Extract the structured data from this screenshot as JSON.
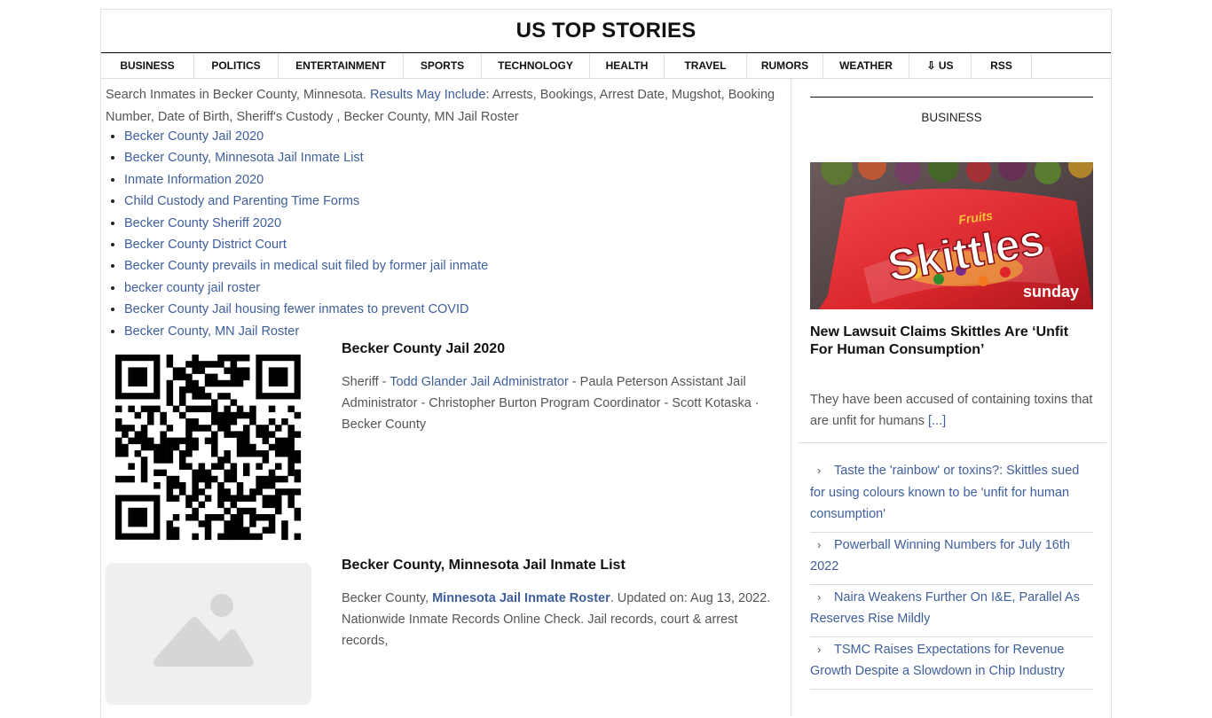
{
  "site": {
    "title": "US TOP STORIES"
  },
  "nav": [
    {
      "label": "BUSINESS",
      "w": 105
    },
    {
      "label": "POLITICS",
      "w": 95
    },
    {
      "label": "ENTERTAINMENT",
      "w": 141
    },
    {
      "label": "SPORTS",
      "w": 88
    },
    {
      "label": "TECHNOLOGY",
      "w": 122
    },
    {
      "label": "HEALTH",
      "w": 84
    },
    {
      "label": "TRAVEL",
      "w": 93
    },
    {
      "label": "RUMORS",
      "w": 86
    },
    {
      "label": "WEATHER",
      "w": 97
    },
    {
      "label": "⇩ US",
      "w": 70
    },
    {
      "label": "RSS",
      "w": 68
    }
  ],
  "intro": {
    "lead": "Search Inmates in Becker County, Minnesota. ",
    "link": "Results May Include",
    "rest": ": Arrests, Bookings, Arrest Date, Mugshot, Booking Number, Date of Birth, Sheriff's Custody ,  Becker County, MN Jail Roster"
  },
  "results": [
    "Becker County Jail 2020",
    "Becker County, Minnesota Jail Inmate List",
    "Inmate Information 2020",
    "Child Custody and Parenting Time Forms",
    "Becker County Sheriff 2020",
    "Becker County District Court",
    "Becker County prevails in medical suit filed by former jail inmate",
    "becker county jail roster",
    "Becker County Jail housing fewer inmates to prevent COVID",
    "Becker County, MN Jail Roster"
  ],
  "card1": {
    "title": "Becker County Jail 2020",
    "t1": "Sheriff - ",
    "link": "Todd Glander Jail Administrator",
    "t2": " - Paula Peterson Assistant Jail Administrator - Christopher Burton Program Coordinator - Scott Kotaska · Becker County"
  },
  "card2": {
    "title": "Becker County, Minnesota Jail Inmate List",
    "t1": "Becker County, ",
    "link": "Minnesota Jail Inmate Roster",
    "t2": ". Updated on: Aug 13, 2022. Nationwide Inmate Records Online Check. Jail records, court & arrest records,"
  },
  "sidebar": {
    "heading": "BUSINESS",
    "feature_title": "New Lawsuit Claims Skittles Are ‘Unfit For Human Consumption’",
    "excerpt": "They have been accused of containing toxins that are unfit for humans ",
    "more": "[...]",
    "image_words": {
      "fruits": "Fruits",
      "brand": "Skittles",
      "corner": "sunday"
    },
    "links": [
      "Taste the 'rainbow' or toxins?: Skittles sued for using colours known to be 'unfit for human consumption'",
      "Powerball Winning Numbers for July 16th 2022",
      "Naira Weakens Further On I&E, Parallel As Reserves Rise Mildly",
      "TSMC Raises Expectations for Revenue Growth Despite a Slowdown in Chip Industry"
    ]
  },
  "colors": {
    "link": "#3e5f9c",
    "text": "#555555",
    "title": "#111111",
    "skittles_red": "#d9262c"
  },
  "icons": [
    "qr-code-icon",
    "image-placeholder-icon",
    "chevron-right-icon"
  ]
}
